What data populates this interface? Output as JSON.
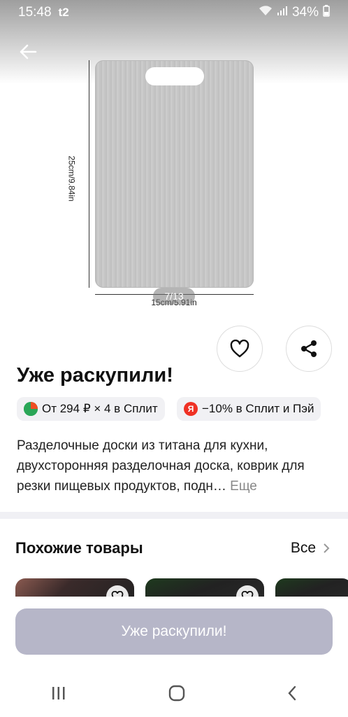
{
  "status_bar": {
    "time": "15:48",
    "carrier_icon": "t2-icon",
    "battery": "34%"
  },
  "gallery": {
    "height_label": "25cm/9.84in",
    "width_label": "15cm/5.91in",
    "page_indicator": "7/13"
  },
  "product": {
    "title": "Уже раскупили!",
    "split_chip": "От 294 ₽ × 4 в Сплит",
    "yandex_chip": "−10% в Сплит и Пэй",
    "yandex_chip_icon_letter": "Я",
    "description": "Разделочные доски из титана для кухни, двухсторонняя разделочная доска, коврик для резки пищевых продуктов, подн…",
    "more_label": "Еще"
  },
  "similar": {
    "title": "Похожие товары",
    "all_label": "Все"
  },
  "cta": {
    "label": "Уже раскупили!"
  },
  "colors": {
    "cta_disabled": "#b6b6c8",
    "chip_bg": "#f1f1f4",
    "split_green": "#2aa657",
    "yandex_red": "#ef3124"
  }
}
